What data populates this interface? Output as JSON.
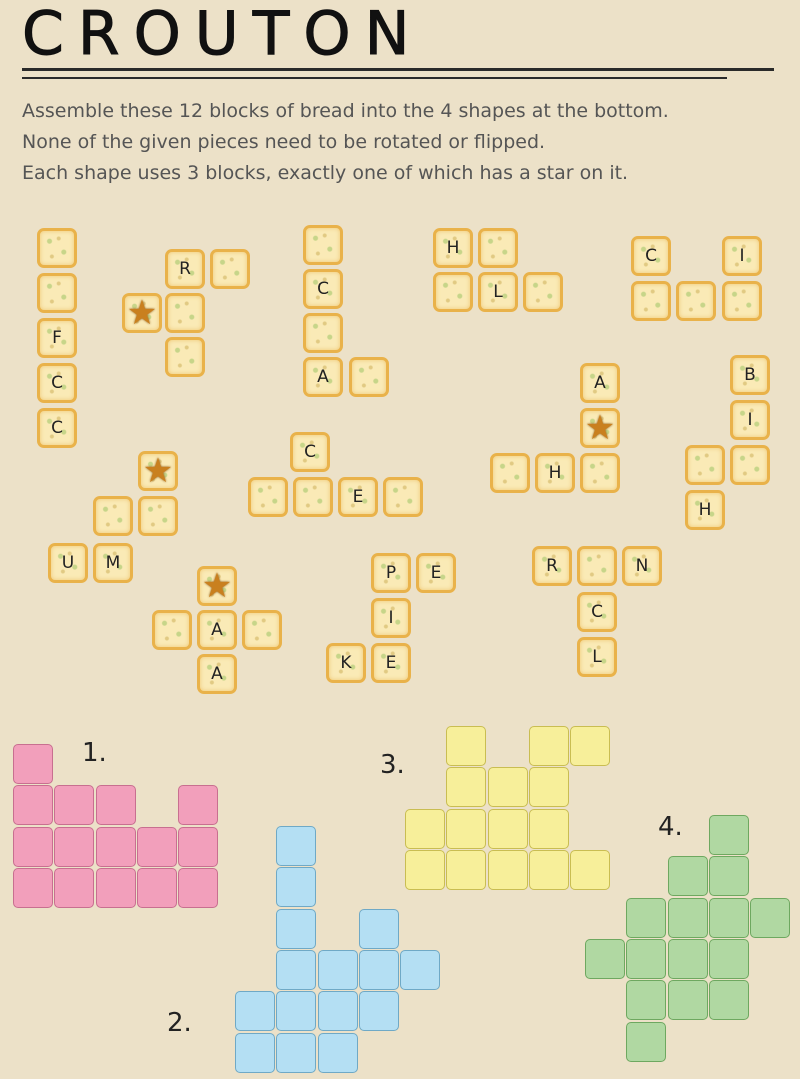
{
  "title": "CROUTON",
  "instructions": [
    "Assemble these 12 blocks of bread into the 4 shapes at the bottom.",
    "None of the given pieces need to be rotated or flipped.",
    "Each shape uses 3 blocks, exactly one of which has a star on it."
  ],
  "pieces": [
    {
      "name": "piece-1",
      "tiles": [
        {
          "c": 37,
          "r": 228,
          "t": ""
        },
        {
          "c": 37,
          "r": 273,
          "t": ""
        },
        {
          "c": 37,
          "r": 318,
          "t": "F"
        },
        {
          "c": 37,
          "r": 363,
          "t": "C"
        },
        {
          "c": 37,
          "r": 408,
          "t": "C"
        }
      ]
    },
    {
      "name": "piece-2",
      "tiles": [
        {
          "c": 165,
          "r": 249,
          "t": "R"
        },
        {
          "c": 210,
          "r": 249,
          "t": ""
        },
        {
          "c": 122,
          "r": 293,
          "t": "★"
        },
        {
          "c": 165,
          "r": 293,
          "t": ""
        },
        {
          "c": 165,
          "r": 337,
          "t": ""
        }
      ]
    },
    {
      "name": "piece-3",
      "tiles": [
        {
          "c": 303,
          "r": 225,
          "t": ""
        },
        {
          "c": 303,
          "r": 269,
          "t": "C"
        },
        {
          "c": 303,
          "r": 313,
          "t": ""
        },
        {
          "c": 303,
          "r": 357,
          "t": "A"
        },
        {
          "c": 349,
          "r": 357,
          "t": ""
        }
      ]
    },
    {
      "name": "piece-4",
      "tiles": [
        {
          "c": 433,
          "r": 228,
          "t": "H"
        },
        {
          "c": 478,
          "r": 228,
          "t": ""
        },
        {
          "c": 433,
          "r": 272,
          "t": ""
        },
        {
          "c": 478,
          "r": 272,
          "t": "L"
        },
        {
          "c": 523,
          "r": 272,
          "t": ""
        }
      ]
    },
    {
      "name": "piece-5",
      "tiles": [
        {
          "c": 631,
          "r": 236,
          "t": "C"
        },
        {
          "c": 722,
          "r": 236,
          "t": "I"
        },
        {
          "c": 631,
          "r": 281,
          "t": ""
        },
        {
          "c": 676,
          "r": 281,
          "t": ""
        },
        {
          "c": 722,
          "r": 281,
          "t": ""
        }
      ]
    },
    {
      "name": "piece-6",
      "tiles": [
        {
          "c": 580,
          "r": 363,
          "t": "A"
        },
        {
          "c": 580,
          "r": 408,
          "t": "★"
        },
        {
          "c": 490,
          "r": 453,
          "t": ""
        },
        {
          "c": 535,
          "r": 453,
          "t": "H"
        },
        {
          "c": 580,
          "r": 453,
          "t": ""
        }
      ]
    },
    {
      "name": "piece-7",
      "tiles": [
        {
          "c": 730,
          "r": 355,
          "t": "B"
        },
        {
          "c": 730,
          "r": 400,
          "t": "I"
        },
        {
          "c": 685,
          "r": 445,
          "t": ""
        },
        {
          "c": 730,
          "r": 445,
          "t": ""
        },
        {
          "c": 685,
          "r": 490,
          "t": "H"
        }
      ]
    },
    {
      "name": "piece-8",
      "tiles": [
        {
          "c": 290,
          "r": 432,
          "t": "C"
        },
        {
          "c": 248,
          "r": 477,
          "t": ""
        },
        {
          "c": 293,
          "r": 477,
          "t": ""
        },
        {
          "c": 338,
          "r": 477,
          "t": "E"
        },
        {
          "c": 383,
          "r": 477,
          "t": ""
        }
      ]
    },
    {
      "name": "piece-9",
      "tiles": [
        {
          "c": 138,
          "r": 451,
          "t": "★"
        },
        {
          "c": 93,
          "r": 496,
          "t": ""
        },
        {
          "c": 138,
          "r": 496,
          "t": ""
        },
        {
          "c": 48,
          "r": 543,
          "t": "U"
        },
        {
          "c": 93,
          "r": 543,
          "t": "M"
        }
      ]
    },
    {
      "name": "piece-10",
      "tiles": [
        {
          "c": 197,
          "r": 566,
          "t": "★"
        },
        {
          "c": 152,
          "r": 610,
          "t": ""
        },
        {
          "c": 197,
          "r": 610,
          "t": "A"
        },
        {
          "c": 242,
          "r": 610,
          "t": ""
        },
        {
          "c": 197,
          "r": 654,
          "t": "A"
        }
      ]
    },
    {
      "name": "piece-11",
      "tiles": [
        {
          "c": 371,
          "r": 553,
          "t": "P"
        },
        {
          "c": 416,
          "r": 553,
          "t": "E"
        },
        {
          "c": 371,
          "r": 598,
          "t": "I"
        },
        {
          "c": 326,
          "r": 643,
          "t": "K"
        },
        {
          "c": 371,
          "r": 643,
          "t": "E"
        }
      ]
    },
    {
      "name": "piece-12",
      "tiles": [
        {
          "c": 532,
          "r": 546,
          "t": "R"
        },
        {
          "c": 577,
          "r": 546,
          "t": ""
        },
        {
          "c": 622,
          "r": 546,
          "t": "N"
        },
        {
          "c": 577,
          "r": 592,
          "t": "C"
        },
        {
          "c": 577,
          "r": 637,
          "t": "L"
        }
      ]
    }
  ],
  "shapes": [
    {
      "label": "1.",
      "fill": "#f29fbb",
      "stroke": "#c86f90",
      "cells": [
        [
          0,
          0
        ],
        [
          0,
          1
        ],
        [
          1,
          1
        ],
        [
          2,
          1
        ],
        [
          4,
          1
        ],
        [
          0,
          2
        ],
        [
          1,
          2
        ],
        [
          2,
          2
        ],
        [
          3,
          2
        ],
        [
          4,
          2
        ],
        [
          0,
          3
        ],
        [
          1,
          3
        ],
        [
          2,
          3
        ],
        [
          3,
          3
        ],
        [
          4,
          3
        ]
      ]
    },
    {
      "label": "2.",
      "fill": "#b4dff3",
      "stroke": "#6fa9c6",
      "cells": [
        [
          1,
          0
        ],
        [
          1,
          1
        ],
        [
          1,
          2
        ],
        [
          3,
          2
        ],
        [
          1,
          3
        ],
        [
          2,
          3
        ],
        [
          3,
          3
        ],
        [
          4,
          3
        ],
        [
          0,
          4
        ],
        [
          1,
          4
        ],
        [
          2,
          4
        ],
        [
          3,
          4
        ],
        [
          0,
          5
        ],
        [
          1,
          5
        ],
        [
          2,
          5
        ]
      ]
    },
    {
      "label": "3.",
      "fill": "#f7ef9a",
      "stroke": "#c9bd52",
      "cells": [
        [
          1,
          0
        ],
        [
          3,
          0
        ],
        [
          4,
          0
        ],
        [
          1,
          1
        ],
        [
          2,
          1
        ],
        [
          3,
          1
        ],
        [
          0,
          2
        ],
        [
          1,
          2
        ],
        [
          2,
          2
        ],
        [
          3,
          2
        ],
        [
          0,
          3
        ],
        [
          1,
          3
        ],
        [
          2,
          3
        ],
        [
          3,
          3
        ],
        [
          4,
          3
        ]
      ]
    },
    {
      "label": "4.",
      "fill": "#b0d8a2",
      "stroke": "#6ea860",
      "cells": [
        [
          3,
          0
        ],
        [
          2,
          1
        ],
        [
          3,
          1
        ],
        [
          1,
          2
        ],
        [
          2,
          2
        ],
        [
          3,
          2
        ],
        [
          4,
          2
        ],
        [
          0,
          3
        ],
        [
          1,
          3
        ],
        [
          2,
          3
        ],
        [
          3,
          3
        ],
        [
          1,
          4
        ],
        [
          2,
          4
        ],
        [
          3,
          4
        ],
        [
          1,
          5
        ]
      ]
    }
  ]
}
